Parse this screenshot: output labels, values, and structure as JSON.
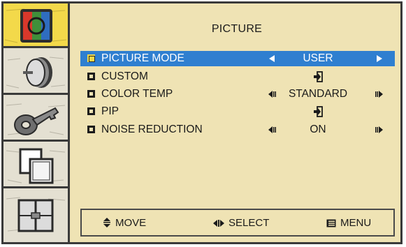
{
  "screen": {
    "title": "PICTURE"
  },
  "sidebar": {
    "items": [
      {
        "icon": "picture-tab-icon",
        "active": true
      },
      {
        "icon": "sound-tab-icon",
        "active": false
      },
      {
        "icon": "lock-tab-icon",
        "active": false
      },
      {
        "icon": "pip-tab-icon",
        "active": false
      },
      {
        "icon": "setup-tab-icon",
        "active": false
      }
    ]
  },
  "menu": {
    "items": [
      {
        "label": "PICTURE MODE",
        "value": "USER",
        "control": "arrows",
        "selected": true
      },
      {
        "label": "CUSTOM",
        "value": "",
        "control": "enter",
        "selected": false
      },
      {
        "label": "COLOR TEMP",
        "value": "STANDARD",
        "control": "arrows",
        "selected": false
      },
      {
        "label": "PIP",
        "value": "",
        "control": "enter",
        "selected": false
      },
      {
        "label": "NOISE REDUCTION",
        "value": "ON",
        "control": "arrows",
        "selected": false
      }
    ]
  },
  "footer": {
    "move_label": "MOVE",
    "select_label": "SELECT",
    "menu_label": "MENU"
  },
  "colors": {
    "background": "#efe3b4",
    "highlight": "#2f7fd0",
    "active_tab": "#f3d94a",
    "border": "#3a3a3a"
  }
}
